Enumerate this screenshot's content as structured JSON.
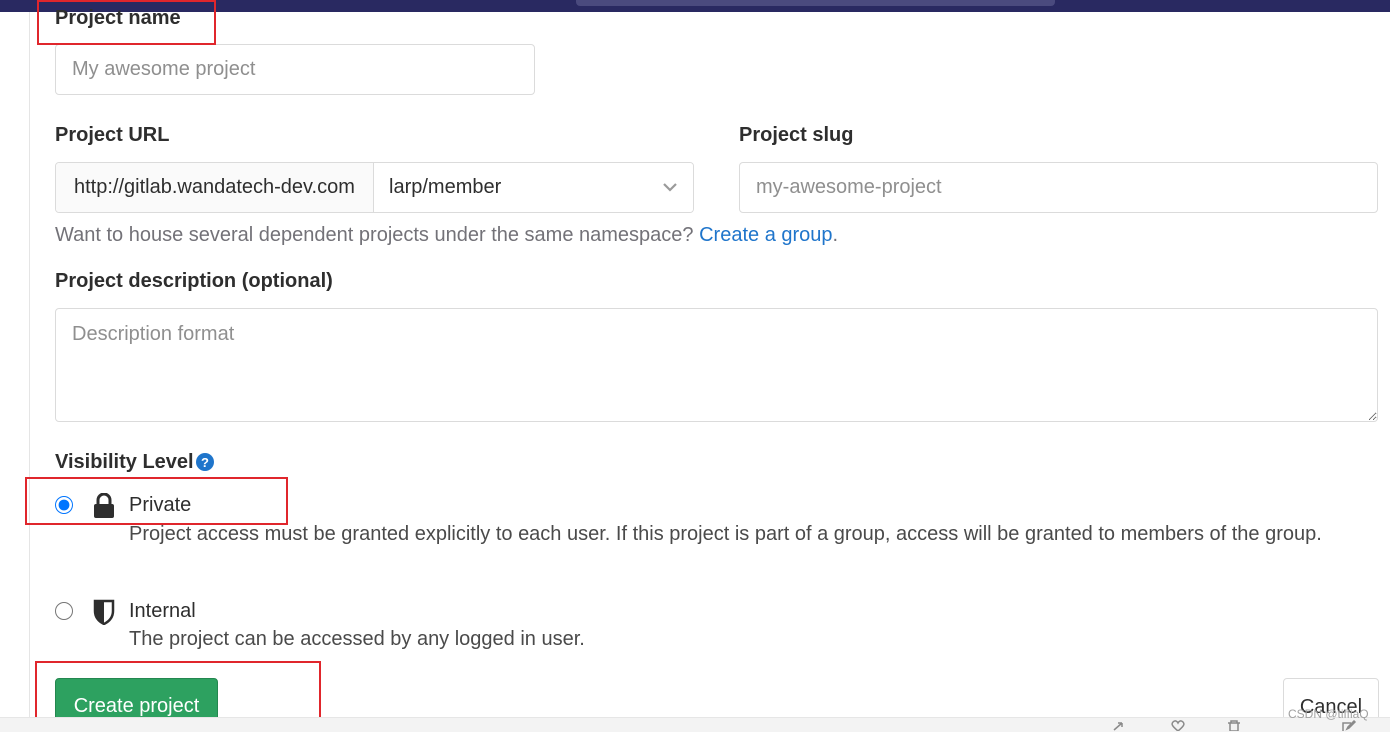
{
  "form": {
    "project_name": {
      "label": "Project name",
      "placeholder": "My awesome project",
      "value": ""
    },
    "project_url": {
      "label": "Project URL",
      "prefix": "http://gitlab.wandatech-dev.com",
      "namespace": "larp/member"
    },
    "project_slug": {
      "label": "Project slug",
      "placeholder": "my-awesome-project",
      "value": ""
    },
    "group_help": {
      "text": "Want to house several dependent projects under the same namespace? ",
      "link": "Create a group",
      "suffix": "."
    },
    "description": {
      "label": "Project description (optional)",
      "placeholder": "Description format",
      "value": ""
    },
    "visibility": {
      "label": "Visibility Level",
      "selected": "private",
      "options": [
        {
          "title": "Private",
          "icon": "lock-icon",
          "description": "Project access must be granted explicitly to each user. If this project is part of a group, access will be granted to members of the group."
        },
        {
          "title": "Internal",
          "icon": "shield-icon",
          "description": "The project can be accessed by any logged in user."
        }
      ]
    },
    "create_button": "Create project",
    "cancel_button": "Cancel"
  },
  "watermark": "CSDN @tiffiaQ",
  "colors": {
    "primary_button": "#2da160",
    "link": "#1f75cb",
    "highlight": "#e0262c",
    "topbar": "#292961"
  }
}
